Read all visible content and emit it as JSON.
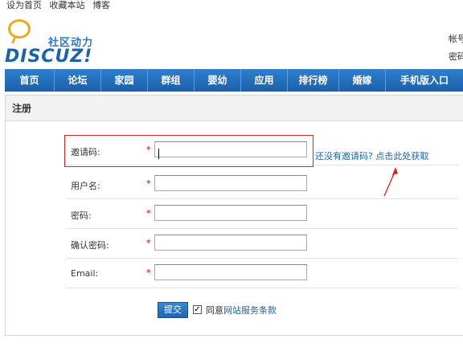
{
  "top_links": [
    "设为首页",
    "收藏本站",
    "博客"
  ],
  "logo": {
    "tagline": "社区动力",
    "wordmark": "DISCUZ!"
  },
  "right_labels": [
    "帐号",
    "密码"
  ],
  "nav": {
    "items": [
      "首页",
      "论坛",
      "家园",
      "群组",
      "婴幼",
      "应用",
      "排行榜",
      "婚嫁",
      "手机版入口"
    ]
  },
  "panel": {
    "title": "注册"
  },
  "form": {
    "fields": [
      {
        "label": "邀请码:",
        "required": "*",
        "value": ""
      },
      {
        "label": "用户名:",
        "required": "*",
        "value": ""
      },
      {
        "label": "密码:",
        "required": "*",
        "value": ""
      },
      {
        "label": "确认密码:",
        "required": "*",
        "value": ""
      },
      {
        "label": "Email:",
        "required": "*",
        "value": ""
      }
    ],
    "invite_hint": "还没有邀请码? 点击此处获取",
    "submit_label": "提交",
    "agree_checked": "✓",
    "agree_prefix": "同意",
    "agree_link": "网站服务条款"
  },
  "colors": {
    "nav": "#1b5faa",
    "highlight": "#dd2222",
    "link": "#1a63b0",
    "logo_accent": "#f0a81e"
  }
}
